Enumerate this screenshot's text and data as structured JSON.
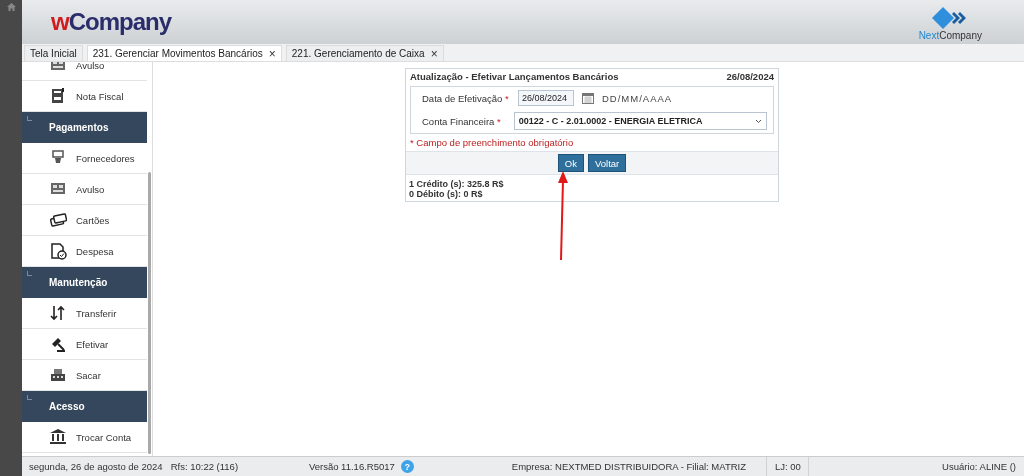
{
  "header": {
    "logo": {
      "prefix": "w",
      "rest": "Company"
    },
    "brand": {
      "prefix": "Next",
      "rest": "Company"
    }
  },
  "tabs": [
    {
      "label": "Tela Inicial",
      "selected": false,
      "closable": false
    },
    {
      "label": "231. Gerenciar Movimentos Bancários",
      "selected": true,
      "closable": true
    },
    {
      "label": "221. Gerenciamento de Caixa",
      "selected": false,
      "closable": true
    }
  ],
  "close_glyph": "×",
  "sidebar": {
    "items": [
      {
        "kind": "item",
        "label": "Avulso"
      },
      {
        "kind": "item",
        "label": "Nota Fiscal"
      },
      {
        "kind": "section",
        "label": "Pagamentos"
      },
      {
        "kind": "item",
        "label": "Fornecedores"
      },
      {
        "kind": "item",
        "label": "Avulso"
      },
      {
        "kind": "item",
        "label": "Cartões"
      },
      {
        "kind": "item",
        "label": "Despesa"
      },
      {
        "kind": "section",
        "label": "Manutenção"
      },
      {
        "kind": "item",
        "label": "Transferir"
      },
      {
        "kind": "item",
        "label": "Efetivar"
      },
      {
        "kind": "item",
        "label": "Sacar"
      },
      {
        "kind": "section",
        "label": "Acesso"
      },
      {
        "kind": "item",
        "label": "Trocar Conta"
      }
    ]
  },
  "dialog": {
    "title": "Atualização - Efetivar Lançamentos Bancários",
    "date": "26/08/2024",
    "fields": [
      {
        "kind": "date",
        "label": "Data de Efetivação",
        "required_mark": "*",
        "value": "26/08/2024",
        "hint": "DD/MM/AAAA"
      },
      {
        "kind": "select",
        "label": "Conta Financeira",
        "required_mark": "*",
        "value": "00122 - C - 2.01.0002 - ENERGIA ELETRICA"
      }
    ],
    "required_note": "* Campo de preenchimento obrigatório",
    "buttons": [
      "Ok",
      "Voltar"
    ],
    "summary": [
      "1 Crédito (s): 325.8 R$",
      "0 Débito (s): 0 R$"
    ]
  },
  "status_bar": {
    "date": "segunda, 26 de agosto de 2024",
    "refresh": "Rfs: 10:22 (116)",
    "version": "Versão 11.16.R5017",
    "help": "?",
    "company": "Empresa: NEXTMED DISTRIBUIDORA - Filial: MATRIZ",
    "store": "LJ: 00",
    "user": "Usuário: ALINE ()"
  }
}
